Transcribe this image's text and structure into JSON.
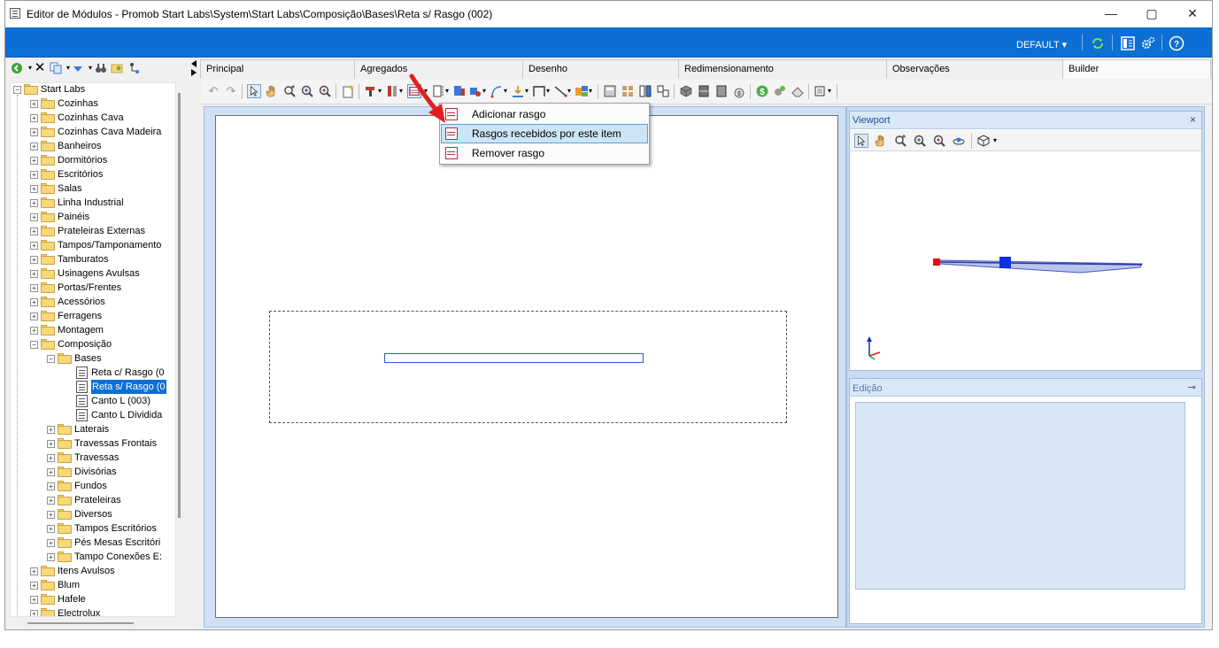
{
  "window": {
    "title": "Editor de Módulos - Promob Start Labs\\System\\Start Labs\\Composição\\Bases\\Reta s/ Rasgo (002)",
    "minimize": "—",
    "maximize": "▢",
    "close": "✕"
  },
  "topbar": {
    "profile": "DEFAULT",
    "profile_arrow": "▾"
  },
  "tabs": [
    "Principal",
    "Agregados",
    "Desenho",
    "Redimensionamento",
    "Observações",
    "Builder"
  ],
  "active_tab": "Builder",
  "tree": {
    "root": "Start Labs",
    "folders": [
      "Cozinhas",
      "Cozinhas Cava",
      "Cozinhas Cava Madeira",
      "Banheiros",
      "Dormitórios",
      "Escritórios",
      "Salas",
      "Linha Industrial",
      "Painéis",
      "Prateleiras Externas",
      "Tampos/Tamponamento",
      "Tamburatos",
      "Usinagens Avulsas",
      "Portas/Frentes",
      "Acessórios",
      "Ferragens",
      "Montagem",
      "Composição"
    ],
    "composicao_children": [
      "Bases"
    ],
    "bases_items": [
      "Reta c/ Rasgo (0",
      "Reta s/ Rasgo (0",
      "Canto L (003)",
      "Canto L Dividida"
    ],
    "composicao_rest": [
      "Laterais",
      "Travessas Frontais",
      "Travessas",
      "Divisórias",
      "Fundos",
      "Prateleiras",
      "Diversos",
      "Tampos Escritórios",
      "Pés Mesas Escritóri",
      "Tampo Conexões E:"
    ],
    "after": [
      "Itens Avulsos",
      "Blum",
      "Hafele",
      "Electrolux"
    ],
    "selected": "Reta s/ Rasgo (0"
  },
  "context_menu": {
    "items": [
      "Adicionar rasgo",
      "Rasgos recebidos por este item",
      "Remover rasgo"
    ],
    "highlighted_index": 1
  },
  "viewport": {
    "title": "Viewport",
    "close": "×"
  },
  "edicao": {
    "title": "Edição",
    "pin": "⊸"
  },
  "colors": {
    "accent": "#0c6fd4",
    "arrow": "#e02020"
  }
}
